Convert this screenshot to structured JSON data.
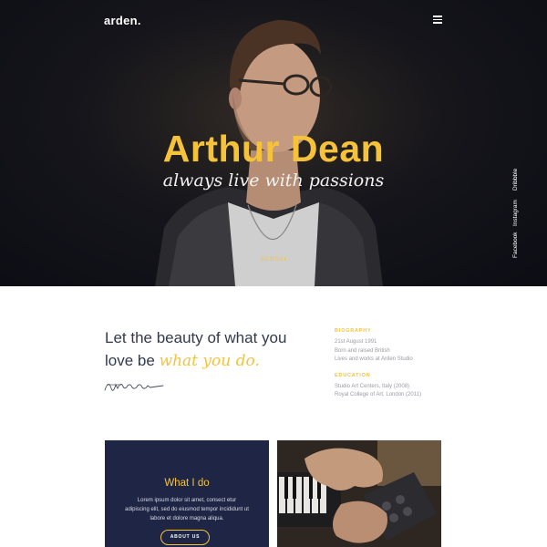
{
  "brand": {
    "logo": "arden."
  },
  "hero": {
    "title": "Arthur Dean",
    "subtitle": "always live with passions",
    "scroll_label": "SCROLL"
  },
  "social": [
    {
      "label": "Dribbble"
    },
    {
      "label": "Instagram"
    },
    {
      "label": "Facebook"
    }
  ],
  "about": {
    "heading_line1": "Let the beauty of what you",
    "heading_line2_prefix": "love be ",
    "heading_accent": "what you do.",
    "biography_label": "BIOGRAPHY",
    "biography": [
      "21st August 1991",
      "Born and raised British",
      "Lives and works at Arden Studio"
    ],
    "education_label": "EDUCATION",
    "education": [
      "Studio Art Centers, Italy (2008)",
      "Royal College of Art, London (2011)"
    ]
  },
  "service_card": {
    "title": "What I do",
    "text": "Lorem ipsum dolor sit amet, consect etur adipiscing elit, sed do eiusmod tempor incididunt ut labore et dolore magna aliqua.",
    "button_label": "ABOUT US"
  },
  "colors": {
    "accent": "#f5c23a",
    "navy": "#1f2645",
    "hero_bg": "#0c0d14",
    "heading_text": "#333a4d"
  },
  "icons": {
    "menu": "hamburger-menu-icon"
  }
}
